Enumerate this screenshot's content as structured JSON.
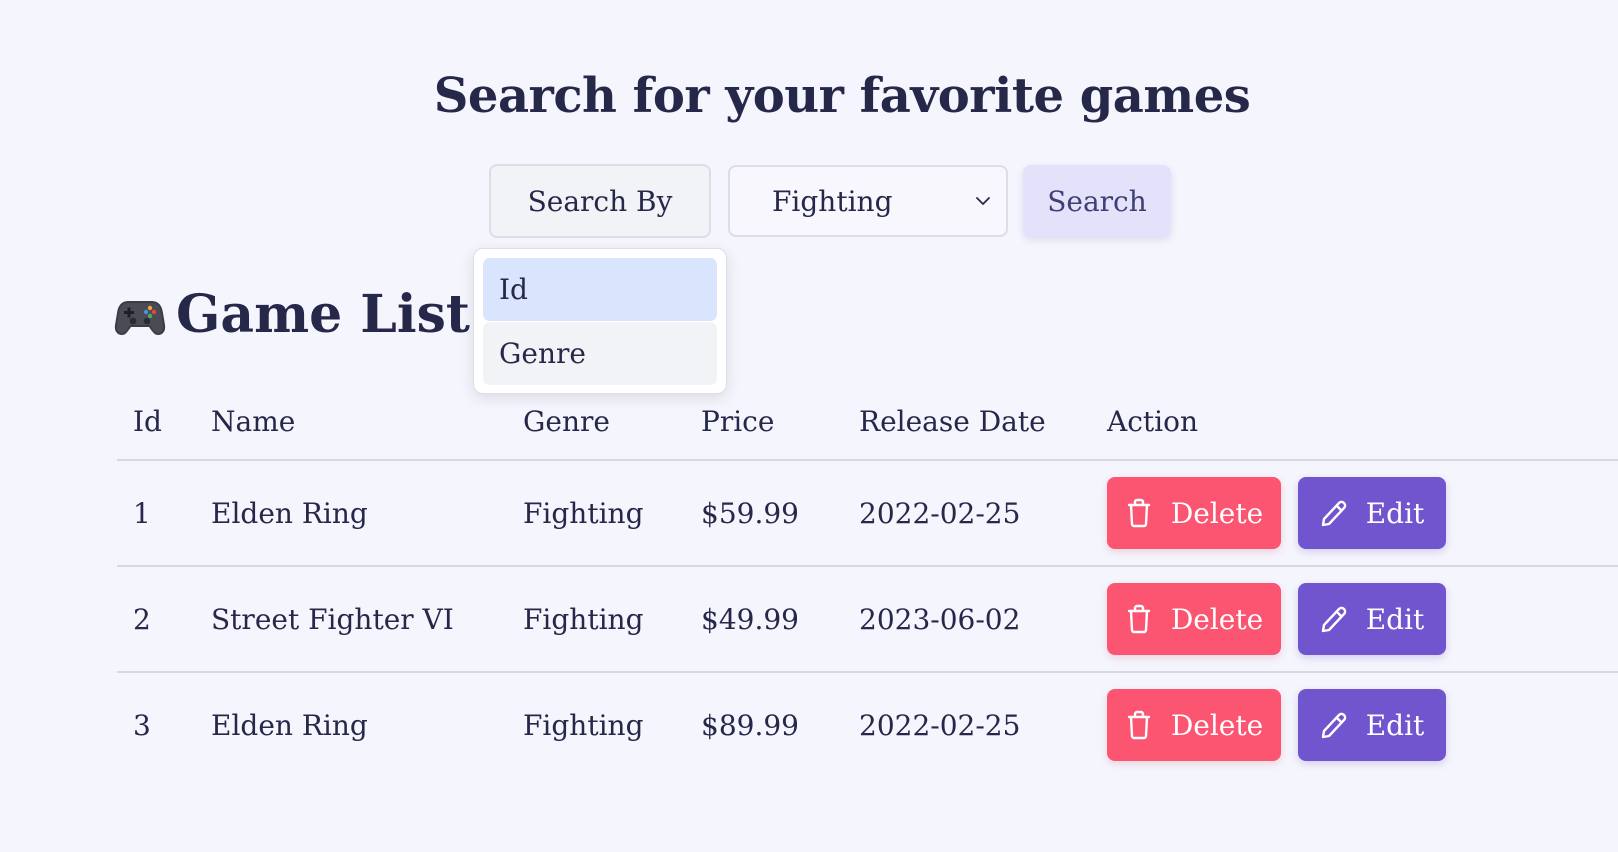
{
  "page": {
    "title": "Search for your favorite games"
  },
  "search": {
    "search_by_label": "Search By",
    "selected_genre": "Fighting",
    "search_button_label": "Search",
    "dropdown_options": [
      "Id",
      "Genre"
    ],
    "dropdown_active": "Id"
  },
  "list": {
    "title": "Game List",
    "title_icon": "game-controller-icon",
    "columns": [
      "Id",
      "Name",
      "Genre",
      "Price",
      "Release Date",
      "Action"
    ],
    "rows": [
      {
        "id": "1",
        "name": "Elden Ring",
        "genre": "Fighting",
        "price": "$59.99",
        "release_date": "2022-02-25",
        "delete_label": "Delete",
        "edit_label": "Edit"
      },
      {
        "id": "2",
        "name": "Street Fighter VI",
        "genre": "Fighting",
        "price": "$49.99",
        "release_date": "2023-06-02",
        "delete_label": "Delete",
        "edit_label": "Edit"
      },
      {
        "id": "3",
        "name": "Elden Ring",
        "genre": "Fighting",
        "price": "$89.99",
        "release_date": "2022-02-25",
        "delete_label": "Delete",
        "edit_label": "Edit"
      }
    ]
  },
  "colors": {
    "background": "#f5f5fd",
    "text": "#26284a",
    "delete": "#fb5571",
    "edit": "#7055cf",
    "search_button": "#e4e1fb",
    "dropdown_active": "#d9e5fc"
  }
}
